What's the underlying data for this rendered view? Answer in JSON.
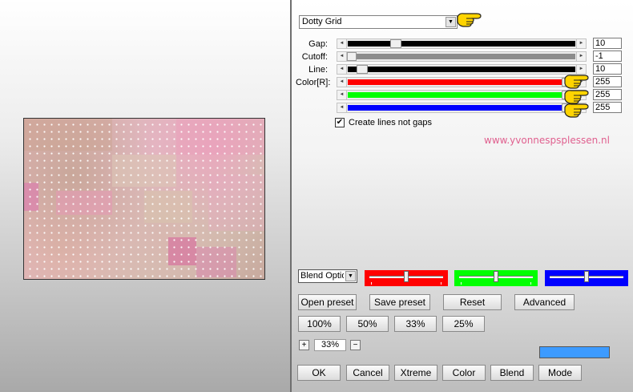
{
  "filter": {
    "name": "Dotty Grid"
  },
  "params": {
    "gap": {
      "label": "Gap:",
      "value": "10"
    },
    "cutoff": {
      "label": "Cutoff:",
      "value": "-1"
    },
    "line": {
      "label": "Line:",
      "value": "10"
    },
    "color_r": {
      "label": "Color[R]:",
      "value": "255"
    },
    "color_g": {
      "value": "255"
    },
    "color_b": {
      "value": "255"
    }
  },
  "checkbox": {
    "label": "Create lines not gaps",
    "checked": "✔"
  },
  "watermark": "www.yvonnespsplessen.nl",
  "blend": {
    "value": "Blend Options"
  },
  "buttons": {
    "open_preset": "Open preset",
    "save_preset": "Save preset",
    "reset": "Reset",
    "advanced": "Advanced",
    "z100": "100%",
    "z50": "50%",
    "z33": "33%",
    "z25": "25%",
    "ok": "OK",
    "cancel": "Cancel",
    "xtreme": "Xtreme",
    "color": "Color",
    "blend": "Blend",
    "mode": "Mode"
  },
  "zoom": {
    "plus": "+",
    "value": "33%",
    "minus": "−"
  },
  "icons": {
    "dropdown_arrow": "▼",
    "scroll_left": "◄",
    "scroll_right": "►",
    "pointing_hand": "pointing-hand-icon"
  },
  "colors": {
    "red": "#ff0000",
    "green": "#00ff00",
    "blue": "#0000ff",
    "accent_blue": "#3d9bff",
    "watermark": "#e0608f"
  }
}
